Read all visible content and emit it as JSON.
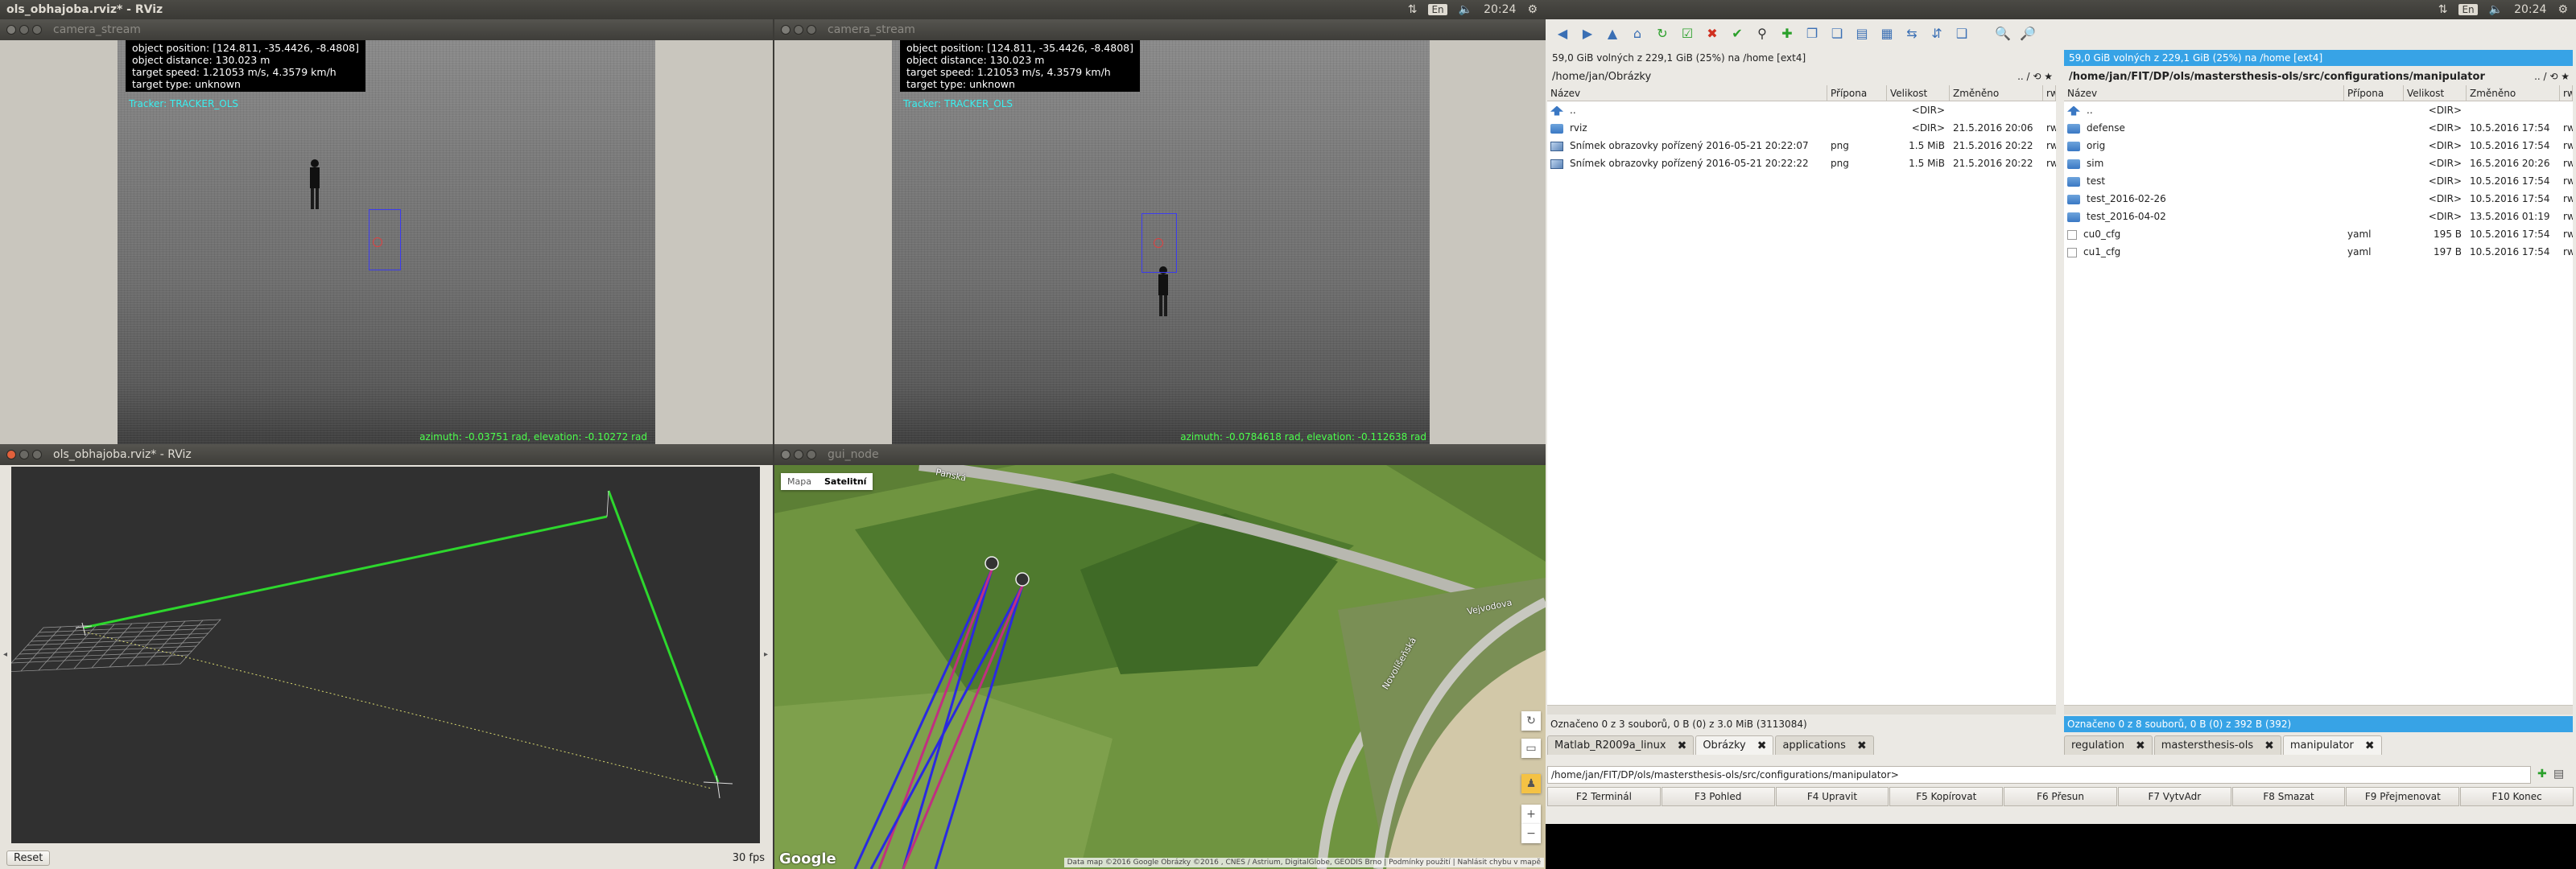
{
  "left_panel": {
    "title": "ols_obhajoba.rviz* - RViz",
    "kbd": "En",
    "clock": "20:24"
  },
  "right_panel": {
    "kbd": "En",
    "clock": "20:24"
  },
  "cam1": {
    "title": "camera_stream",
    "info": [
      "object position: [124.811, -35.4426, -8.4808]",
      "object distance: 130.023 m",
      "target speed: 1.21053 m/s, 4.3579 km/h",
      "target type: unknown"
    ],
    "tracker": "Tracker: TRACKER_OLS",
    "estim": "azimuth: -0.03751 rad, elevation: -0.10272 rad"
  },
  "cam2": {
    "title": "camera_stream",
    "info": [
      "object position: [124.811, -35.4426, -8.4808]",
      "object distance: 130.023 m",
      "target speed: 1.21053 m/s, 4.3579 km/h",
      "target type: unknown"
    ],
    "tracker": "Tracker: TRACKER_OLS",
    "estim": "azimuth: -0.0784618 rad, elevation: -0.112638 rad"
  },
  "rviz": {
    "title": "ols_obhajoba.rviz* - RViz",
    "reset": "Reset",
    "fps": "30 fps"
  },
  "gui": {
    "title": "gui_node",
    "maptype_map": "Mapa",
    "maptype_sat": "Satelitní",
    "google": "Google",
    "attribution": "Data map ©2016 Google Obrázky ©2016 , CNES / Astrium, DigitalGlobe, GEODIS Brno | Podmínky použití | Nahlásit chybu v mapě",
    "roads": [
      "Panská",
      "Vejvodova",
      "Novolíšeňská"
    ]
  },
  "dc": {
    "left": {
      "free": "59,0 GiB volných z 229,1 GiB (25%) na /home [ext4]",
      "path": "/home/jan/Obrázky",
      "cols": [
        "Název",
        "Přípona",
        "Velikost",
        "Změněno",
        "rw"
      ],
      "rows": [
        {
          "icon": "up",
          "name": "..",
          "ext": "",
          "size": "<DIR>",
          "date": "",
          "attr": ""
        },
        {
          "icon": "dir",
          "name": "rviz",
          "ext": "",
          "size": "<DIR>",
          "date": "21.5.2016 20:06",
          "attr": "rw"
        },
        {
          "icon": "img",
          "name": "Snímek obrazovky pořízený 2016-05-21 20:22:07",
          "ext": "png",
          "size": "1.5 MiB",
          "date": "21.5.2016 20:22",
          "attr": "rw"
        },
        {
          "icon": "img",
          "name": "Snímek obrazovky pořízený 2016-05-21 20:22:22",
          "ext": "png",
          "size": "1.5 MiB",
          "date": "21.5.2016 20:22",
          "attr": "rw"
        }
      ],
      "status": "Označeno 0 z 3 souborů, 0 B  (0) z 3.0 MiB (3113084)",
      "tabs": [
        "Matlab_R2009a_linux",
        "Obrázky",
        "applications"
      ]
    },
    "right": {
      "free": "59,0 GiB volných z 229,1 GiB (25%) na /home [ext4]",
      "path": "/home/jan/FIT/DP/ols/mastersthesis-ols/src/configurations/manipulator",
      "cols": [
        "Název",
        "Přípona",
        "Velikost",
        "Změněno",
        "rw"
      ],
      "rows": [
        {
          "icon": "up",
          "name": "..",
          "ext": "",
          "size": "<DIR>",
          "date": "",
          "attr": ""
        },
        {
          "icon": "dir",
          "name": "defense",
          "ext": "",
          "size": "<DIR>",
          "date": "10.5.2016 17:54",
          "attr": "rw"
        },
        {
          "icon": "dir",
          "name": "orig",
          "ext": "",
          "size": "<DIR>",
          "date": "10.5.2016 17:54",
          "attr": "rw"
        },
        {
          "icon": "dir",
          "name": "sim",
          "ext": "",
          "size": "<DIR>",
          "date": "16.5.2016 20:26",
          "attr": "rw"
        },
        {
          "icon": "dir",
          "name": "test",
          "ext": "",
          "size": "<DIR>",
          "date": "10.5.2016 17:54",
          "attr": "rw"
        },
        {
          "icon": "dir",
          "name": "test_2016-02-26",
          "ext": "",
          "size": "<DIR>",
          "date": "10.5.2016 17:54",
          "attr": "rw"
        },
        {
          "icon": "dir",
          "name": "test_2016-04-02",
          "ext": "",
          "size": "<DIR>",
          "date": "13.5.2016 01:19",
          "attr": "rw"
        },
        {
          "icon": "doc",
          "name": "cu0_cfg",
          "ext": "yaml",
          "size": "195 B",
          "date": "10.5.2016 17:54",
          "attr": "rw"
        },
        {
          "icon": "doc",
          "name": "cu1_cfg",
          "ext": "yaml",
          "size": "197 B",
          "date": "10.5.2016 17:54",
          "attr": "rw"
        }
      ],
      "status": "Označeno 0 z 8 souborů, 0 B  (0) z 392 B (392)",
      "tabs": [
        "regulation",
        "mastersthesis-ols",
        "manipulator"
      ]
    },
    "cmdpath": "/home/jan/FIT/DP/ols/mastersthesis-ols/src/configurations/manipulator>",
    "fkeys": [
      "F2 Terminál",
      "F3 Pohled",
      "F4 Upravit",
      "F5 Kopírovat",
      "F6 Přesun",
      "F7 VytvAdr",
      "F8 Smazat",
      "F9 Přejmenovat",
      "F10 Konec"
    ]
  },
  "colors": {
    "accent": "#37a3e6",
    "green_line": "#2dd72d",
    "ubuntu_dark": "#3c3b37"
  }
}
